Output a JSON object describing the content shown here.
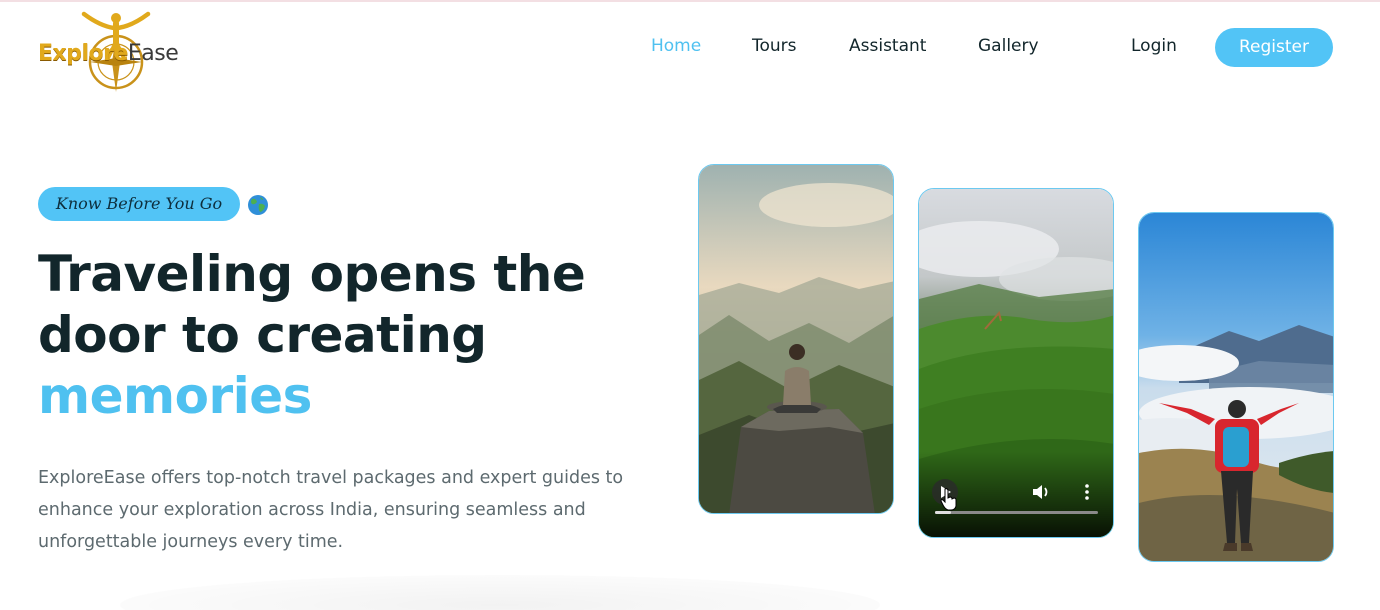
{
  "brand": {
    "logo_part1": "Explore",
    "logo_part2": "Ease"
  },
  "nav": {
    "items": [
      "Home",
      "Tours",
      "Assistant",
      "Gallery"
    ],
    "active": "Home",
    "login": "Login",
    "register": "Register"
  },
  "hero": {
    "tag": "Know Before You Go",
    "tag_icon": "globe-icon",
    "heading_line1": "Traveling opens the",
    "heading_line2": "door to creating",
    "heading_highlight": "memories",
    "description": "ExploreEase offers top-notch travel packages and expert guides to enhance your exploration across India, ensuring seamless and unforgettable journeys every time."
  },
  "media": {
    "cards": [
      {
        "kind": "image",
        "scene": "person meditating on mountain rock"
      },
      {
        "kind": "video",
        "scene": "tea plantation hills in mist",
        "controls": [
          "play-icon",
          "volume-icon",
          "more-options-icon"
        ],
        "progress": 0.1
      },
      {
        "kind": "image",
        "scene": "hiker with arms raised above clouds"
      }
    ]
  },
  "colors": {
    "accent": "#4fc1f0",
    "button": "#52c4f6",
    "heading": "#12262b",
    "body_text": "#5d6a6f",
    "logo_gold": "#e1a91c"
  }
}
